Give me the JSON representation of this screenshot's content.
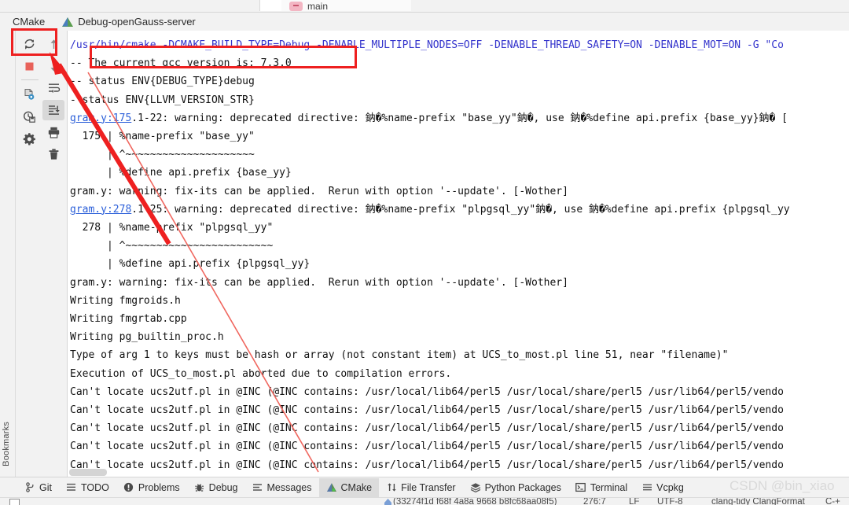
{
  "top_tab": {
    "label": "main",
    "icon": "branch-icon"
  },
  "tool_window": {
    "title": "CMake",
    "config_label": "Debug-openGauss-server",
    "config_icon": "cmake-triangle-icon"
  },
  "bookmarks_rail": {
    "label": "Bookmarks",
    "icon": "bookmark-icon"
  },
  "console_toolbar": {
    "buttons": [
      {
        "name": "rerun-cmake-button",
        "icon": "refresh-icon",
        "tooltip": "Reload CMake Project"
      },
      {
        "name": "scroll-up-button",
        "icon": "arrow-up-icon",
        "tooltip": "Up"
      },
      {
        "name": "stop-button",
        "icon": "stop-square-icon",
        "tooltip": "Stop"
      },
      {
        "name": "scroll-down-button",
        "icon": "arrow-down-icon",
        "tooltip": "Down"
      },
      {
        "name": "cmake-settings-button",
        "icon": "file-gear-icon",
        "tooltip": "CMake Settings"
      },
      {
        "name": "soft-wrap-button",
        "icon": "wrap-text-icon",
        "tooltip": "Soft-Wrap"
      },
      {
        "name": "history-button",
        "icon": "clock-save-icon",
        "tooltip": "History"
      },
      {
        "name": "scroll-to-end-button",
        "icon": "scroll-to-end-icon",
        "tooltip": "Scroll to End",
        "active": true
      },
      {
        "name": "settings-button",
        "icon": "gear-icon",
        "tooltip": "Settings"
      },
      {
        "name": "print-button",
        "icon": "printer-icon",
        "tooltip": "Print"
      },
      {
        "name": "clear-all-button",
        "icon": "trash-icon",
        "tooltip": "Clear All"
      }
    ]
  },
  "console": {
    "lines": [
      {
        "text": "/usr/bin/cmake -DCMAKE_BUILD_TYPE=Debug -DENABLE_MULTIPLE_NODES=OFF -DENABLE_THREAD_SAFETY=ON -DENABLE_MOT=ON -G \"Co",
        "style": "cmd"
      },
      {
        "text": "-- The current gcc version is: 7.3.0",
        "style": "mono"
      },
      {
        "text": "-- status ENV{DEBUG_TYPE}debug",
        "style": "mono"
      },
      {
        "text": "- status ENV{LLVM_VERSION_STR}",
        "style": "mono"
      },
      {
        "text": "gram.y:175.1-22: warning: deprecated directive: 鈉�%name-prefix \"base_yy\"鈉�, use 鈉�%define api.prefix {base_yy}鈉� [",
        "style": "link",
        "link_text": "gram.y:175"
      },
      {
        "text": "  175 | %name-prefix \"base_yy\"",
        "style": "mono"
      },
      {
        "text": "      | ^~~~~~~~~~~~~~~~~~~~~~",
        "style": "mono"
      },
      {
        "text": "      | %define api.prefix {base_yy}",
        "style": "mono"
      },
      {
        "text": "gram.y: warning: fix-its can be applied.  Rerun with option '--update'. [-Wother]",
        "style": "mono"
      },
      {
        "text": "gram.y:278.1-25: warning: deprecated directive: 鈉�%name-prefix \"plpgsql_yy\"鈉�, use 鈉�%define api.prefix {plpgsql_yy",
        "style": "link",
        "link_text": "gram.y:278"
      },
      {
        "text": "  278 | %name-prefix \"plpgsql_yy\"",
        "style": "mono"
      },
      {
        "text": "      | ^~~~~~~~~~~~~~~~~~~~~~~~~",
        "style": "mono"
      },
      {
        "text": "      | %define api.prefix {plpgsql_yy}",
        "style": "mono"
      },
      {
        "text": "gram.y: warning: fix-its can be applied.  Rerun with option '--update'. [-Wother]",
        "style": "mono"
      },
      {
        "text": "Writing fmgroids.h",
        "style": "mono"
      },
      {
        "text": "Writing fmgrtab.cpp",
        "style": "mono"
      },
      {
        "text": "Writing pg_builtin_proc.h",
        "style": "mono"
      },
      {
        "text": "Type of arg 1 to keys must be hash or array (not constant item) at UCS_to_most.pl line 51, near \"filename)\"",
        "style": "mono"
      },
      {
        "text": "Execution of UCS_to_most.pl aborted due to compilation errors.",
        "style": "mono"
      },
      {
        "text": "Can't locate ucs2utf.pl in @INC (@INC contains: /usr/local/lib64/perl5 /usr/local/share/perl5 /usr/lib64/perl5/vendo",
        "style": "mono"
      },
      {
        "text": "Can't locate ucs2utf.pl in @INC (@INC contains: /usr/local/lib64/perl5 /usr/local/share/perl5 /usr/lib64/perl5/vendo",
        "style": "mono"
      },
      {
        "text": "Can't locate ucs2utf.pl in @INC (@INC contains: /usr/local/lib64/perl5 /usr/local/share/perl5 /usr/lib64/perl5/vendo",
        "style": "mono"
      },
      {
        "text": "Can't locate ucs2utf.pl in @INC (@INC contains: /usr/local/lib64/perl5 /usr/local/share/perl5 /usr/lib64/perl5/vendo",
        "style": "mono"
      },
      {
        "text": "Can't locate ucs2utf.pl in @INC (@INC contains: /usr/local/lib64/perl5 /usr/local/share/perl5 /usr/lib64/perl5/vendo",
        "style": "mono"
      }
    ]
  },
  "bottom_tabs": [
    {
      "label": "Git",
      "icon": "git-branch-icon",
      "selected": false
    },
    {
      "label": "TODO",
      "icon": "list-icon",
      "selected": false
    },
    {
      "label": "Problems",
      "icon": "error-circle-icon",
      "selected": false
    },
    {
      "label": "Debug",
      "icon": "bug-icon",
      "selected": false
    },
    {
      "label": "Messages",
      "icon": "lines-icon",
      "selected": false
    },
    {
      "label": "CMake",
      "icon": "cmake-triangle-icon",
      "selected": true
    },
    {
      "label": "File Transfer",
      "icon": "updown-arrows-icon",
      "selected": false
    },
    {
      "label": "Python Packages",
      "icon": "layers-icon",
      "selected": false
    },
    {
      "label": "Terminal",
      "icon": "terminal-icon",
      "selected": false
    },
    {
      "label": "Vcpkg",
      "icon": "hamburger-icon",
      "selected": false
    }
  ],
  "status_bar": {
    "branch_text": "(33274f1d f68f 4a8a 9668 b8fc68aa08f5)",
    "position": "276:7",
    "line_sep": "LF",
    "encoding": "UTF-8",
    "inspections": "clang-tidy  ClangFormat",
    "trailing": "C-+"
  },
  "watermark": {
    "line1": "CSDN @bin_xiao",
    "line2": ""
  },
  "annotations": {
    "toolbar_box": "console-toolbar-highlight",
    "gcc_box": "gcc-version-highlight",
    "cmake_tab_box": "cmake-tab-highlight",
    "arrow": "red-arrow-from-cmake-tab-to-toolbar",
    "color": "#ee2020"
  }
}
